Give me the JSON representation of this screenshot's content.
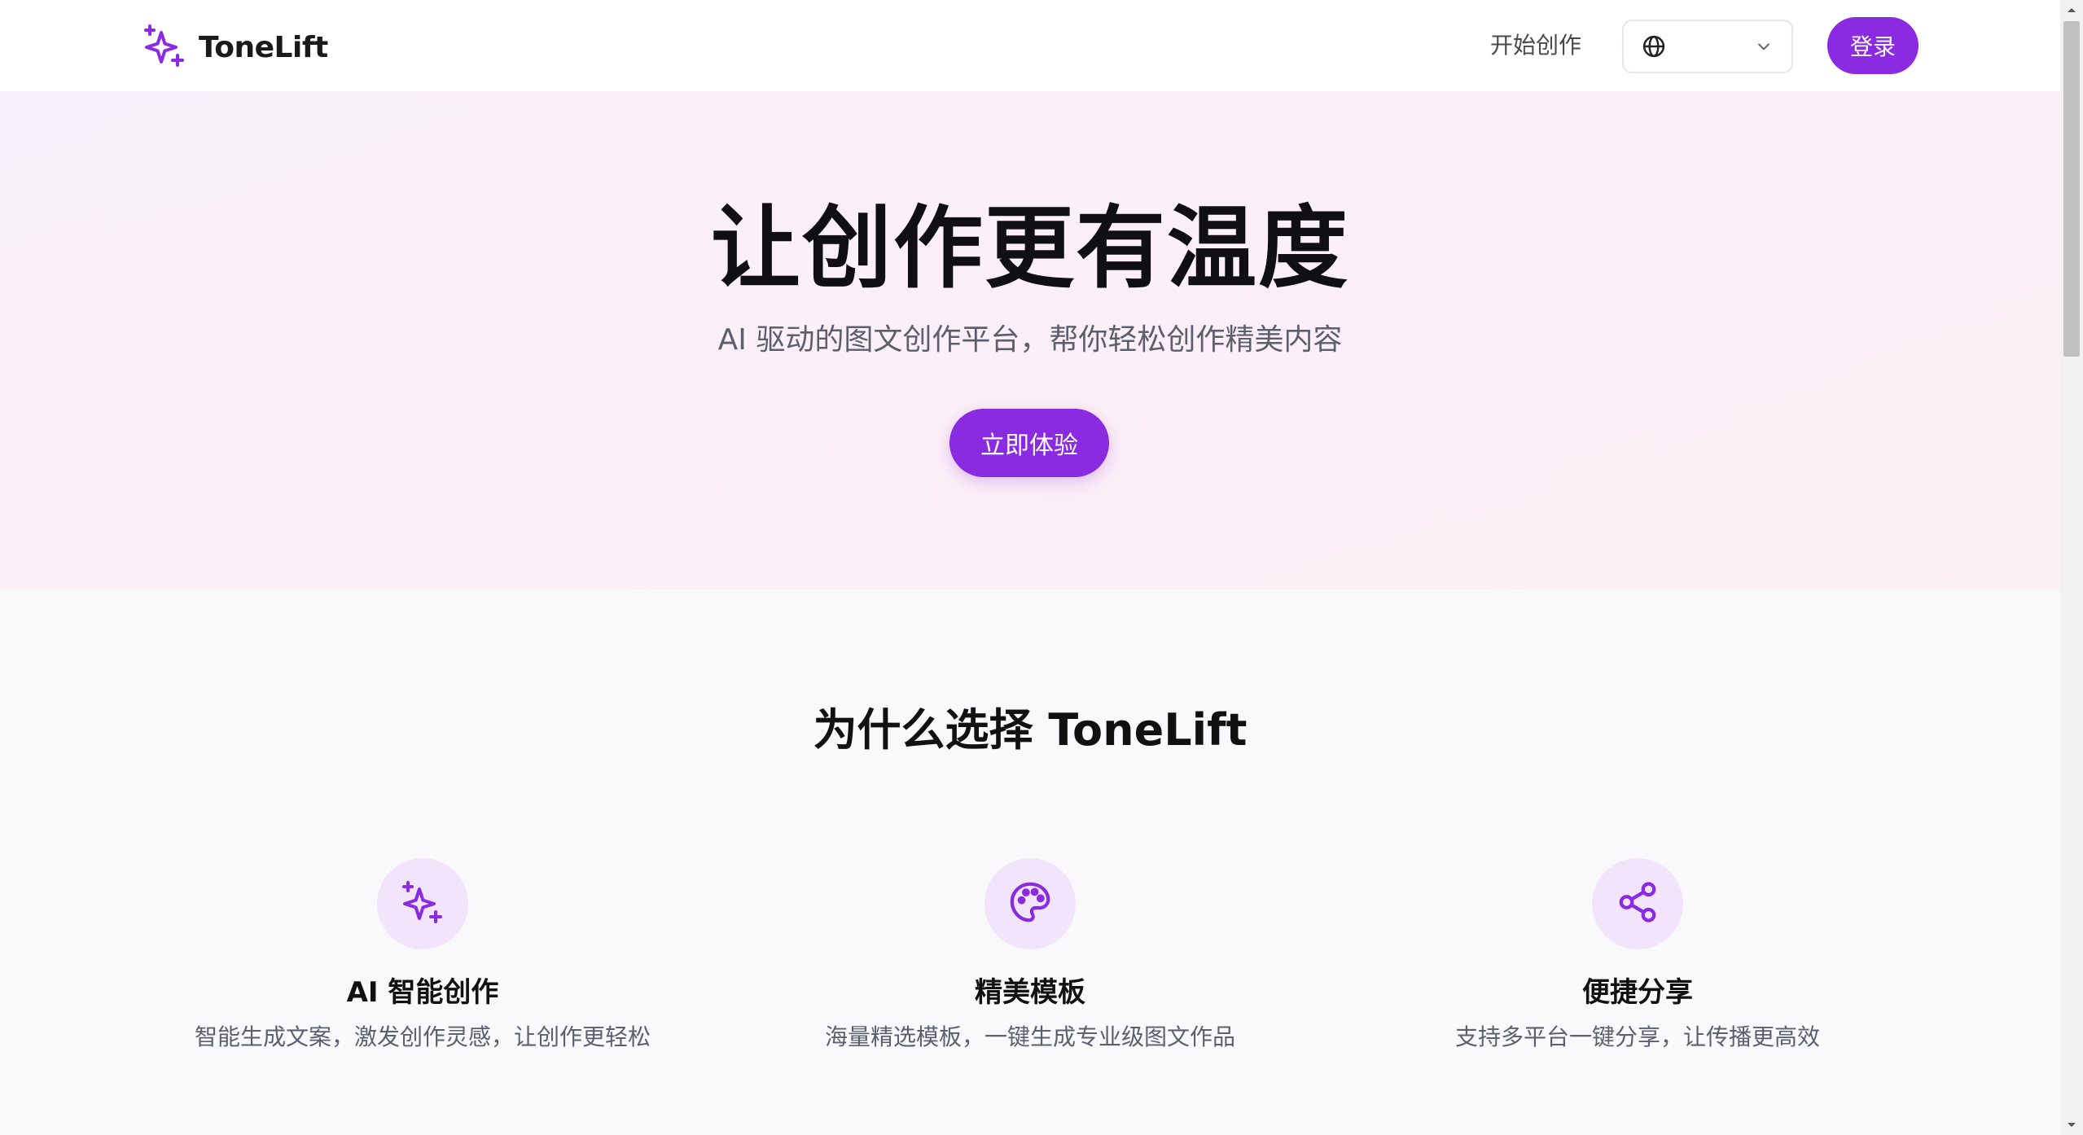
{
  "header": {
    "brand_name": "ToneLift",
    "nav_start_label": "开始创作",
    "language_selector": {
      "icon": "globe-icon",
      "selected_value": ""
    },
    "login_label": "登录"
  },
  "hero": {
    "title": "让创作更有温度",
    "subtitle": "AI 驱动的图文创作平台，帮你轻松创作精美内容",
    "cta_label": "立即体验"
  },
  "features": {
    "heading": "为什么选择 ToneLift",
    "items": [
      {
        "icon": "sparkles-icon",
        "title": "AI 智能创作",
        "description": "智能生成文案，激发创作灵感，让创作更轻松"
      },
      {
        "icon": "palette-icon",
        "title": "精美模板",
        "description": "海量精选模板，一键生成专业级图文作品"
      },
      {
        "icon": "share-icon",
        "title": "便捷分享",
        "description": "支持多平台一键分享，让传播更高效"
      }
    ]
  },
  "colors": {
    "brand_purple": "#8a2be2",
    "hero_background": "#fcf0f8",
    "icon_circle": "#f1e4fb",
    "page_background": "#f9f9fc"
  }
}
